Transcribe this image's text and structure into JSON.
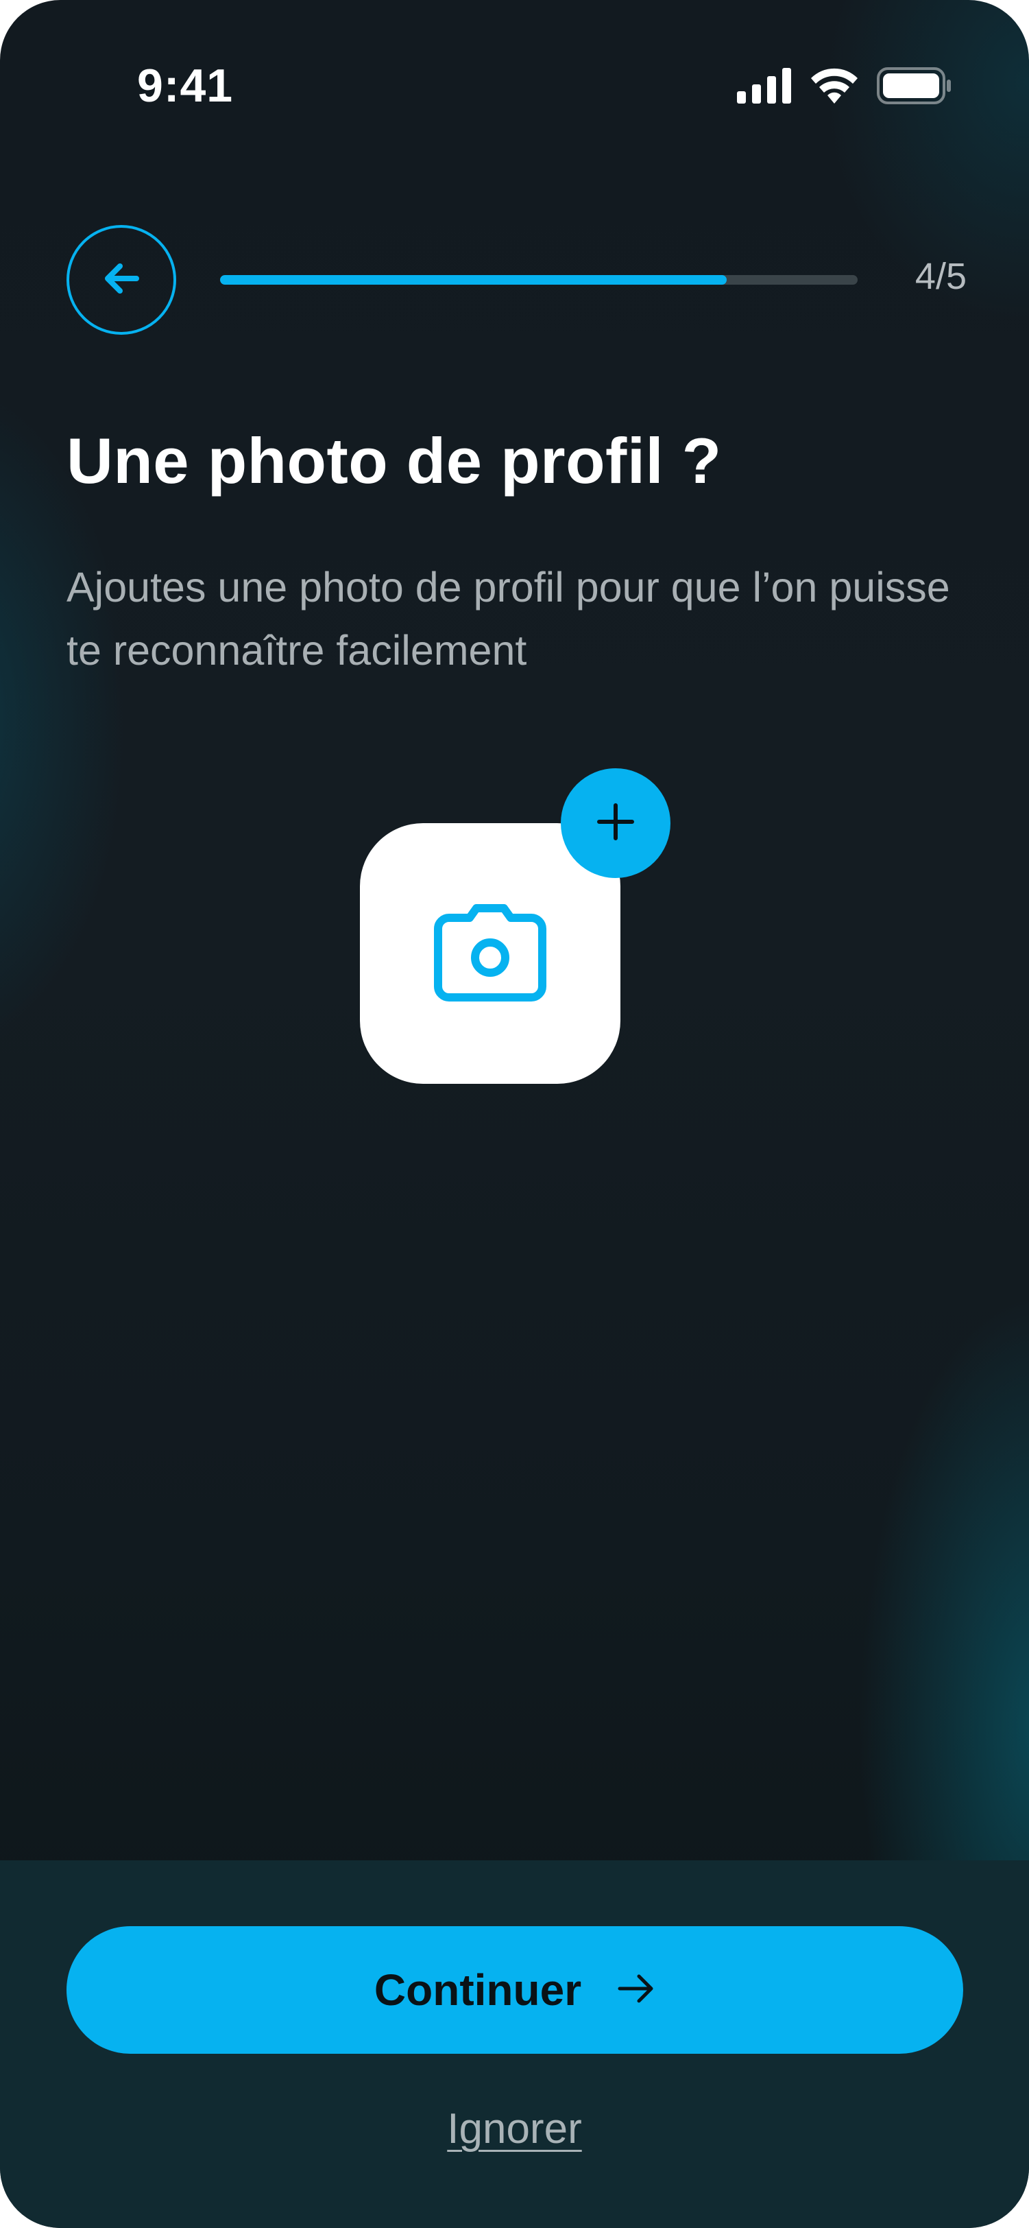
{
  "status_bar": {
    "time": "9:41",
    "icons": [
      "signal-icon",
      "wifi-icon",
      "battery-icon"
    ]
  },
  "header": {
    "back_icon": "arrow-left-icon",
    "progress_label": "4/5",
    "progress_fraction": 0.795
  },
  "main": {
    "title": "Une photo de profil ?",
    "subtitle": "Ajoutes une photo de profil pour que l’on puisse te reconnaître facilement",
    "photo_icon": "camera-icon",
    "add_icon": "plus-icon"
  },
  "footer": {
    "continue_label": "Continuer",
    "continue_icon": "arrow-right-icon",
    "skip_label": "Ignorer"
  },
  "colors": {
    "accent": "#06b2f0",
    "background": "#121a20",
    "panel": "#112a31"
  }
}
